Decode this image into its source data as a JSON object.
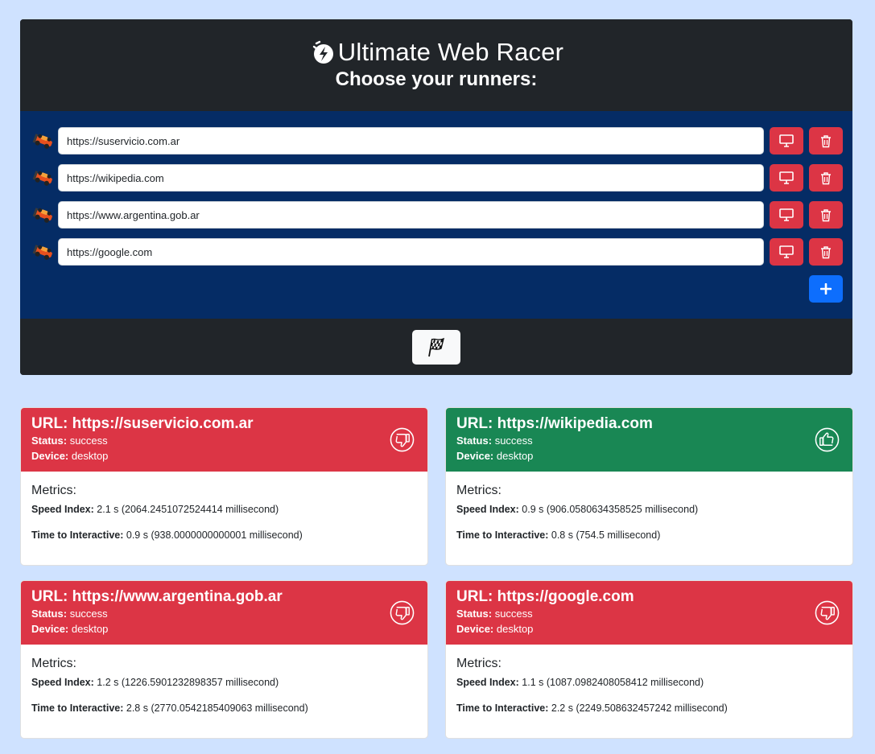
{
  "header": {
    "title": "Ultimate Web Racer",
    "subtitle": "Choose your runners:"
  },
  "runners": [
    {
      "url": "https://suservicio.com.ar"
    },
    {
      "url": "https://wikipedia.com"
    },
    {
      "url": "https://www.argentina.gob.ar"
    },
    {
      "url": "https://google.com"
    }
  ],
  "colors": {
    "page_bg": "#cfe2ff",
    "panel_dark": "#212529",
    "runners_bg": "#052c65",
    "danger": "#dc3545",
    "success": "#198754",
    "primary": "#0d6efd"
  },
  "labels": {
    "url_prefix": "URL:",
    "status": "Status:",
    "device": "Device:",
    "metrics": "Metrics:",
    "speed_index": "Speed Index:",
    "tti": "Time to Interactive:"
  },
  "results": [
    {
      "url": "https://suservicio.com.ar",
      "status": "success",
      "device": "desktop",
      "verdict": "thumbs-down",
      "speed_index": "2.1 s (2064.2451072524414 millisecond)",
      "tti": "0.9 s (938.0000000000001 millisecond)"
    },
    {
      "url": "https://wikipedia.com",
      "status": "success",
      "device": "desktop",
      "verdict": "thumbs-up",
      "speed_index": "0.9 s (906.0580634358525 millisecond)",
      "tti": "0.8 s (754.5 millisecond)"
    },
    {
      "url": "https://www.argentina.gob.ar",
      "status": "success",
      "device": "desktop",
      "verdict": "thumbs-down",
      "speed_index": "1.2 s (1226.5901232898357 millisecond)",
      "tti": "2.8 s (2770.0542185409063 millisecond)"
    },
    {
      "url": "https://google.com",
      "status": "success",
      "device": "desktop",
      "verdict": "thumbs-down",
      "speed_index": "1.1 s (1087.0982408058412 millisecond)",
      "tti": "2.2 s (2249.508632457242 millisecond)"
    }
  ]
}
